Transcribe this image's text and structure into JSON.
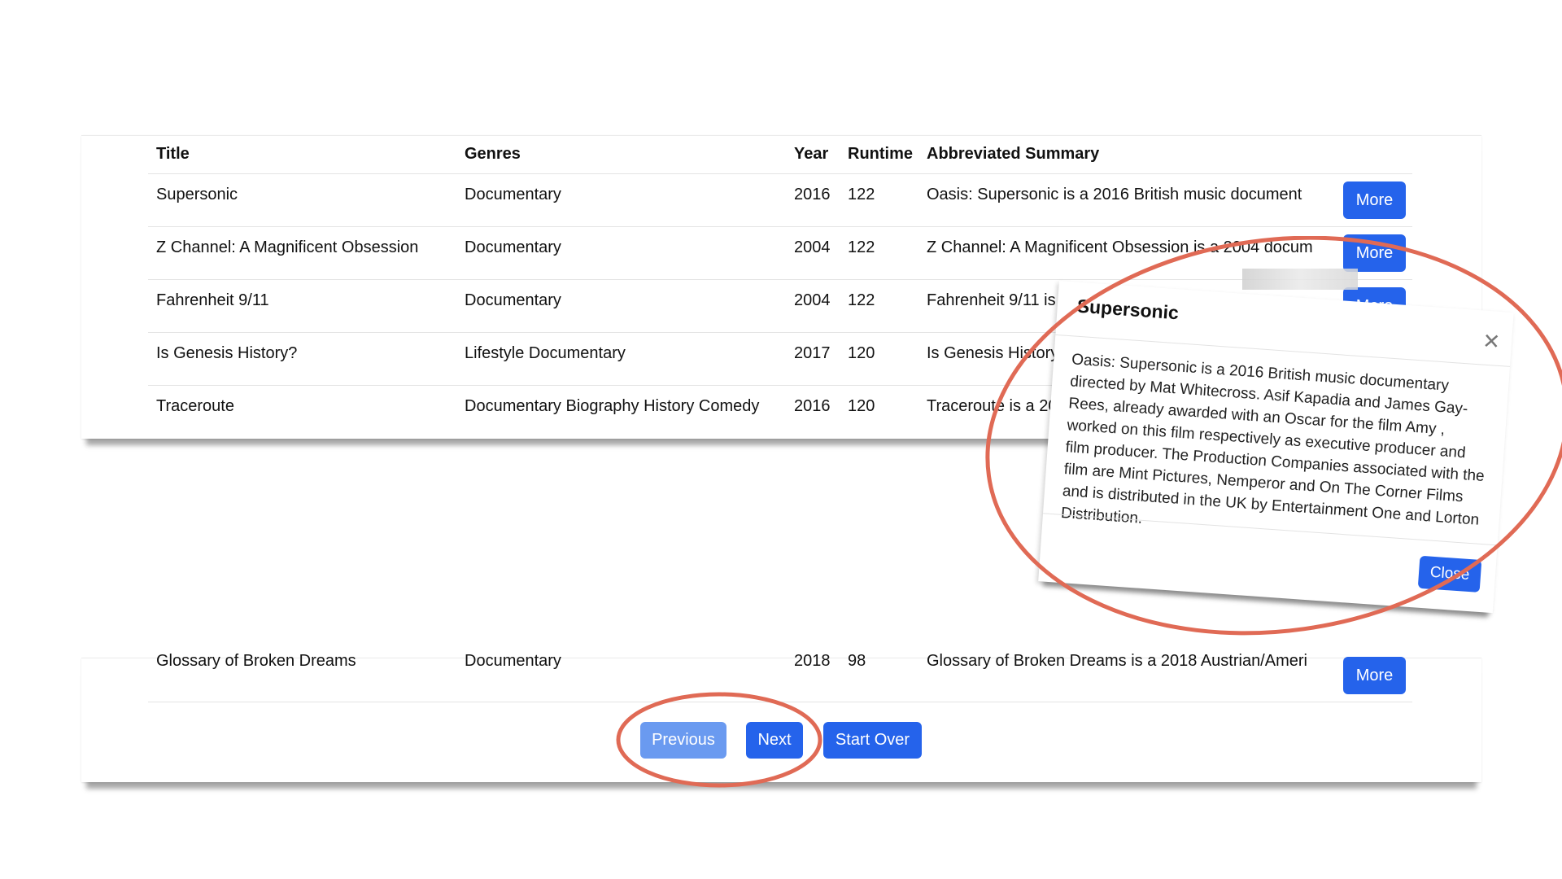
{
  "table": {
    "headers": {
      "title": "Title",
      "genres": "Genres",
      "year": "Year",
      "runtime": "Runtime",
      "summary": "Abbreviated Summary"
    },
    "rows": [
      {
        "title": "Supersonic",
        "genres": "Documentary",
        "year": "2016",
        "runtime": "122",
        "summary": "Oasis: Supersonic is a 2016 British music document",
        "button": "More"
      },
      {
        "title": "Z Channel: A Magnificent Obsession",
        "genres": "Documentary",
        "year": "2004",
        "runtime": "122",
        "summary": "Z Channel: A Magnificent Obsession is a 2004 docum",
        "button": "More"
      },
      {
        "title": "Fahrenheit 9/11",
        "genres": "Documentary",
        "year": "2004",
        "runtime": "122",
        "summary": "Fahrenheit 9/11 is a 2",
        "button": "More"
      },
      {
        "title": "Is Genesis History?",
        "genres": "Lifestyle Documentary",
        "year": "2017",
        "runtime": "120",
        "summary": "Is Genesis History? i",
        "button": ""
      },
      {
        "title": "Traceroute",
        "genres": "Documentary Biography History Comedy",
        "year": "2016",
        "runtime": "120",
        "summary": "Traceroute is a 201",
        "button": ""
      }
    ],
    "bottom_row": {
      "title": "Glossary of Broken Dreams",
      "genres": "Documentary",
      "year": "2018",
      "runtime": "98",
      "summary": "Glossary of Broken Dreams is a 2018 Austrian/Ameri",
      "button": "More"
    }
  },
  "pagination": {
    "previous": "Previous",
    "next": "Next",
    "start_over": "Start Over"
  },
  "modal": {
    "title": "Supersonic",
    "body": "Oasis: Supersonic is a 2016 British music documentary directed by Mat Whitecross. Asif Kapadia and James Gay-Rees, already awarded with an Oscar for the film Amy , worked on this film respectively as executive producer and film producer. The Production Companies associated with the film are Mint Pictures, Nemperor and On The Corner Films and is distributed in the UK by Entertainment One and Lorton Distribution.",
    "close": "Close",
    "x_icon": "close-icon"
  },
  "colors": {
    "primary": "#2563eb",
    "primary_disabled": "#6a9af0",
    "annotation": "#e06a55"
  }
}
